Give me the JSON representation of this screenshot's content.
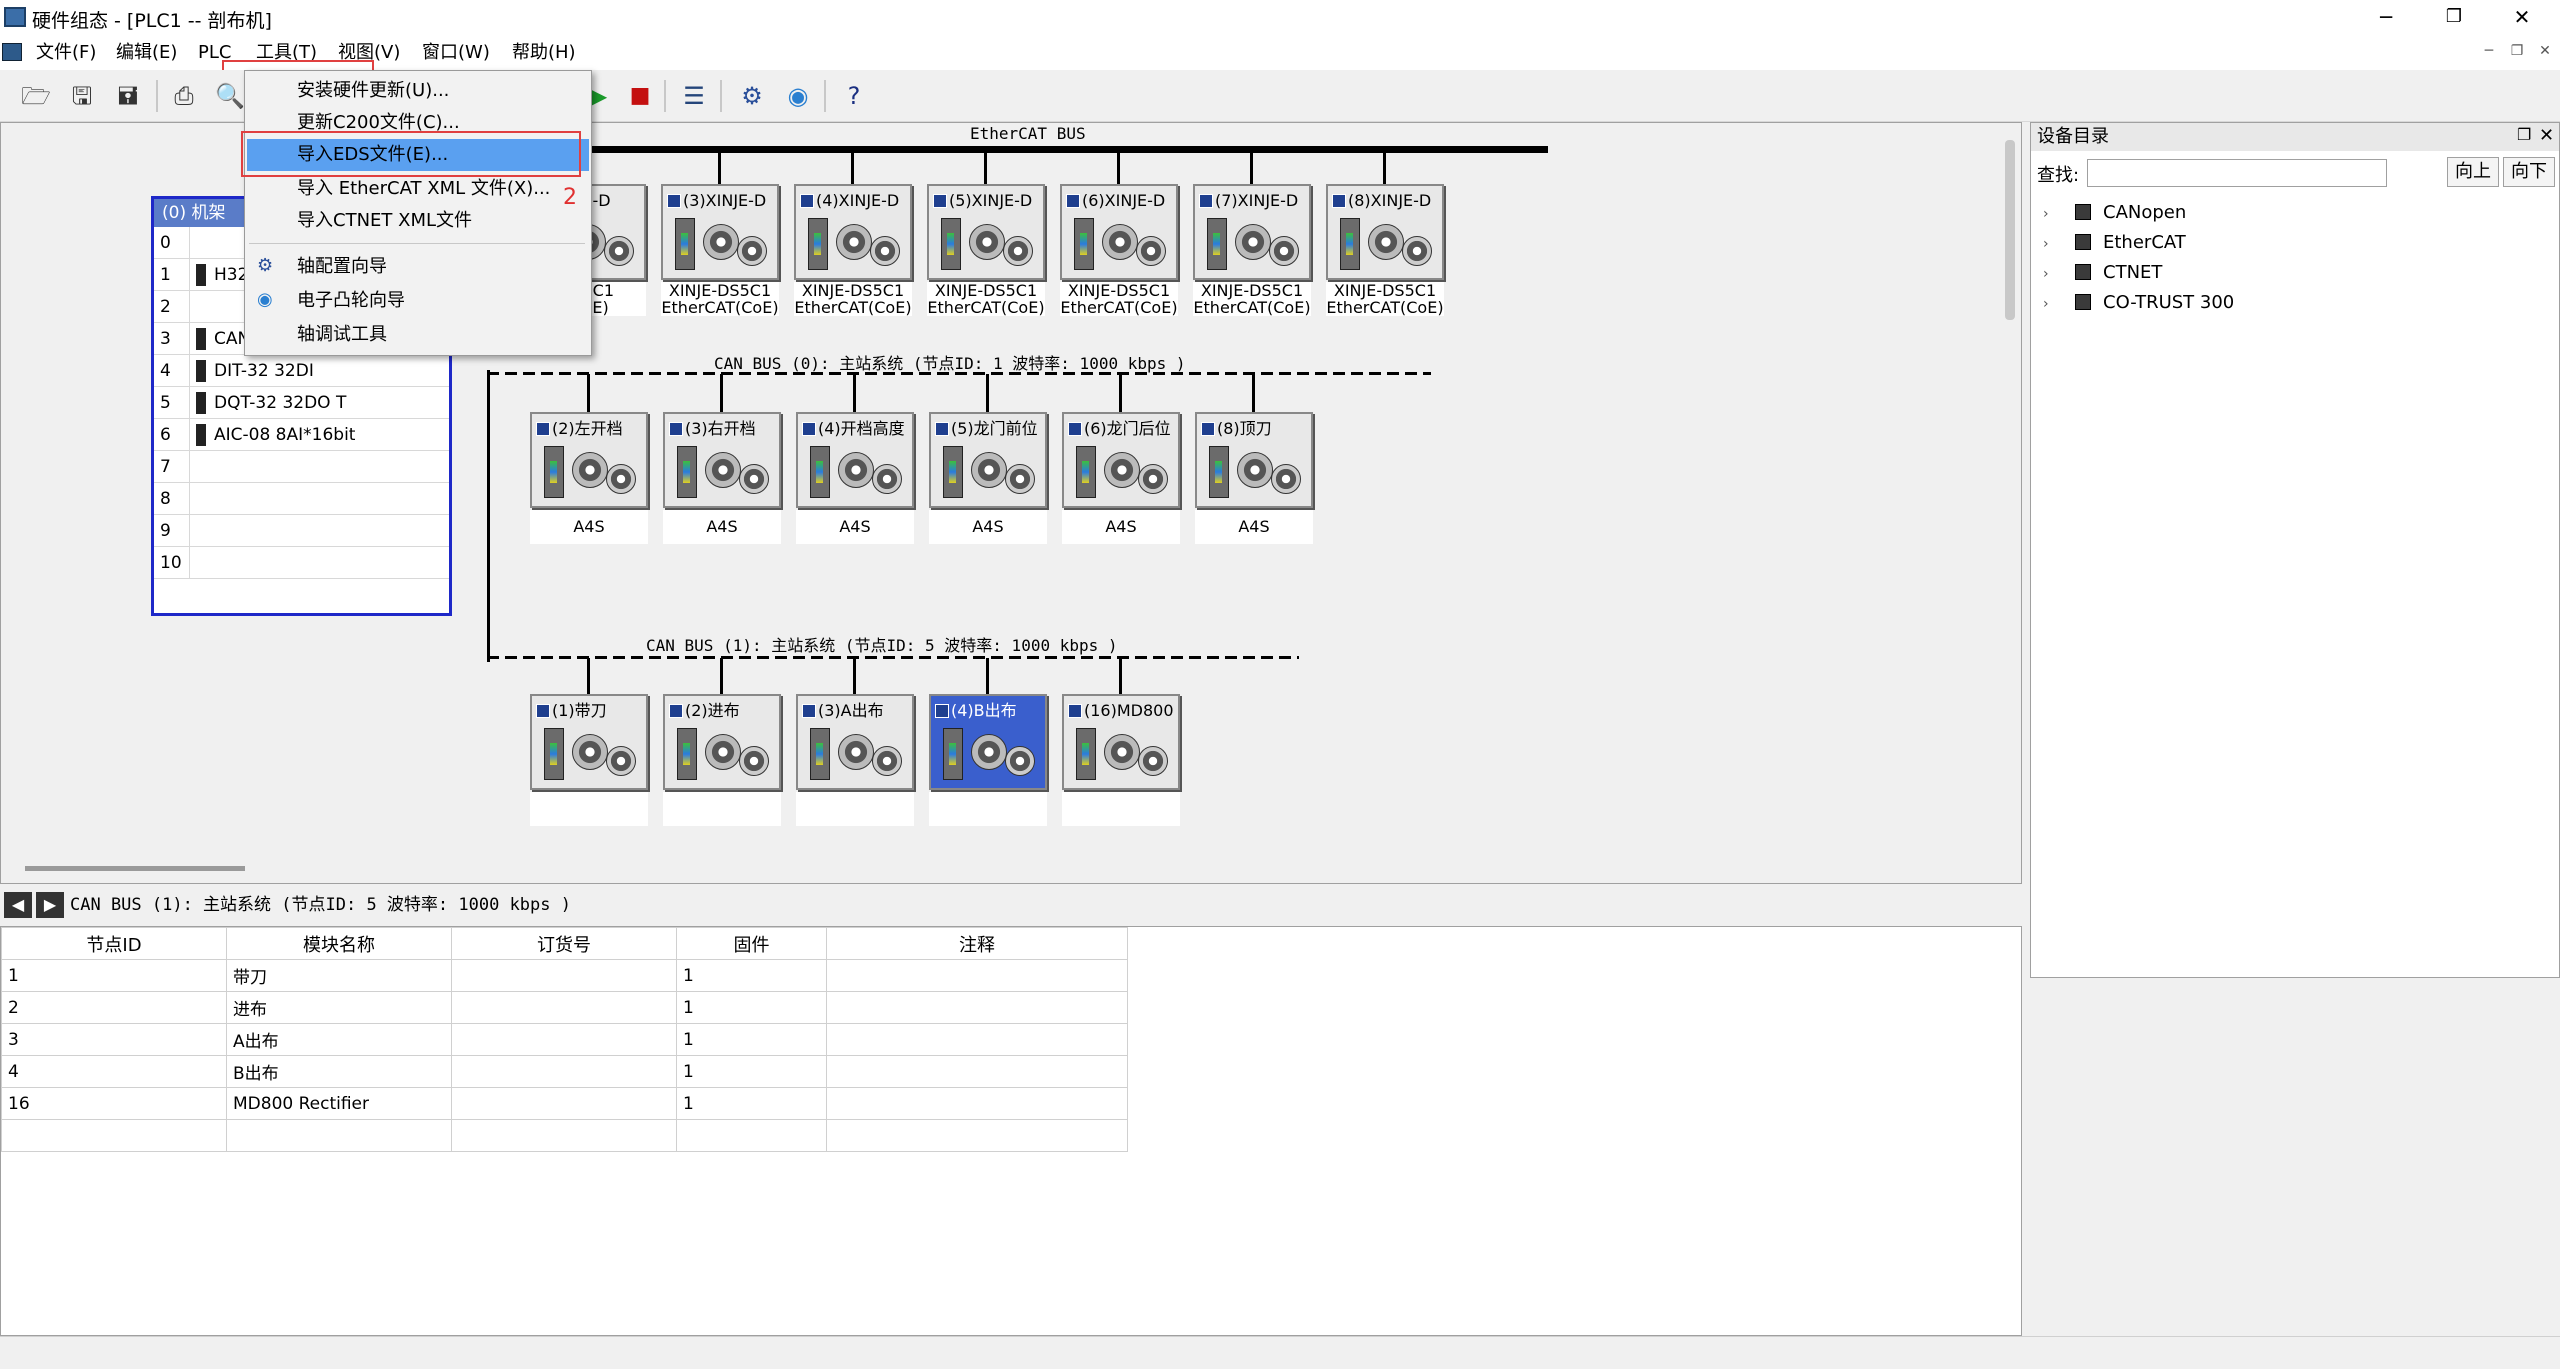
{
  "window": {
    "title": "硬件组态 - [PLC1 -- 剖布机]",
    "controls": {
      "minimize": "─",
      "maximize": "❐",
      "close": "✕"
    }
  },
  "menubar": {
    "items": [
      {
        "label": "文件(F)"
      },
      {
        "label": "编辑(E)"
      },
      {
        "label": "PLC"
      },
      {
        "label": "工具(T)"
      },
      {
        "label": "视图(V)"
      },
      {
        "label": "窗口(W)"
      },
      {
        "label": "帮助(H)"
      }
    ]
  },
  "tools_menu": {
    "items": [
      {
        "label": "安装硬件更新(U)..."
      },
      {
        "label": "更新C200文件(C)..."
      },
      {
        "label": "导入EDS文件(E)..."
      },
      {
        "label": "导入 EtherCAT XML 文件(X)..."
      },
      {
        "label": "导入CTNET XML文件"
      },
      {
        "label": "轴配置向导"
      },
      {
        "label": "电子凸轮向导"
      },
      {
        "label": "轴调试工具"
      }
    ],
    "annotation": "2"
  },
  "rack": {
    "title": "(0) 机架",
    "slots": [
      {
        "slot": "0",
        "module": ""
      },
      {
        "slot": "1",
        "module": "H32"
      },
      {
        "slot": "2",
        "module": ""
      },
      {
        "slot": "3",
        "module": "CAN"
      },
      {
        "slot": "4",
        "module": "DIT-32 32DI"
      },
      {
        "slot": "5",
        "module": "DQT-32 32DO T"
      },
      {
        "slot": "6",
        "module": "AIC-08 8AI*16bit"
      },
      {
        "slot": "7",
        "module": ""
      },
      {
        "slot": "8",
        "module": ""
      },
      {
        "slot": "9",
        "module": ""
      },
      {
        "slot": "10",
        "module": ""
      }
    ]
  },
  "ethercat_bus": {
    "label": "EtherCAT BUS",
    "devices": [
      {
        "title": "XINJE-D",
        "model": "DS5C1",
        "proto": "(CoE)"
      },
      {
        "title": "(3)XINJE-D",
        "model": "XINJE-DS5C1",
        "proto": "EtherCAT(CoE)"
      },
      {
        "title": "(4)XINJE-D",
        "model": "XINJE-DS5C1",
        "proto": "EtherCAT(CoE)"
      },
      {
        "title": "(5)XINJE-D",
        "model": "XINJE-DS5C1",
        "proto": "EtherCAT(CoE)"
      },
      {
        "title": "(6)XINJE-D",
        "model": "XINJE-DS5C1",
        "proto": "EtherCAT(CoE)"
      },
      {
        "title": "(7)XINJE-D",
        "model": "XINJE-DS5C1",
        "proto": "EtherCAT(CoE)"
      },
      {
        "title": "(8)XINJE-D",
        "model": "XINJE-DS5C1",
        "proto": "EtherCAT(CoE)"
      }
    ]
  },
  "can_bus_0": {
    "label": "CAN BUS (0): 主站系统   (节点ID: 1  波特率: 1000 kbps )",
    "devices": [
      {
        "title": "(2)左开档",
        "model": "A4S"
      },
      {
        "title": "(3)右开档",
        "model": "A4S"
      },
      {
        "title": "(4)开档高度",
        "model": "A4S"
      },
      {
        "title": "(5)龙门前位",
        "model": "A4S"
      },
      {
        "title": "(6)龙门后位",
        "model": "A4S"
      },
      {
        "title": "(8)顶刀",
        "model": "A4S"
      }
    ]
  },
  "can_bus_1": {
    "label": "CAN BUS (1): 主站系统   (节点ID: 5  波特率: 1000 kbps )",
    "devices": [
      {
        "title": "(1)带刀",
        "model": ""
      },
      {
        "title": "(2)进布",
        "model": ""
      },
      {
        "title": "(3)A出布",
        "model": ""
      },
      {
        "title": "(4)B出布",
        "model": "",
        "selected": true
      },
      {
        "title": "(16)MD800",
        "model": ""
      }
    ]
  },
  "catalog": {
    "title": "设备目录",
    "search_label": "查找:",
    "search_value": "",
    "btn_up": "向上",
    "btn_down": "向下",
    "tree": [
      {
        "label": "CANopen"
      },
      {
        "label": "EtherCAT"
      },
      {
        "label": "CTNET"
      },
      {
        "label": "CO-TRUST 300"
      }
    ]
  },
  "detail": {
    "title": "CAN BUS (1): 主站系统   (节点ID: 5  波特率: 1000 kbps )",
    "columns": [
      "节点ID",
      "模块名称",
      "订货号",
      "固件",
      "注释"
    ],
    "rows": [
      [
        "1",
        "带刀",
        "",
        "1",
        ""
      ],
      [
        "2",
        "进布",
        "",
        "1",
        ""
      ],
      [
        "3",
        "A出布",
        "",
        "1",
        ""
      ],
      [
        "4",
        "B出布",
        "",
        "1",
        ""
      ],
      [
        "16",
        "MD800 Rectifier",
        "",
        "1",
        ""
      ],
      [
        "",
        "",
        "",
        "",
        ""
      ]
    ]
  },
  "colors": {
    "rack_border": "#1e28c8",
    "menu_highlight": "#5aa0f0",
    "annotation": "#e04040",
    "selected_device": "#3a5fcd"
  }
}
